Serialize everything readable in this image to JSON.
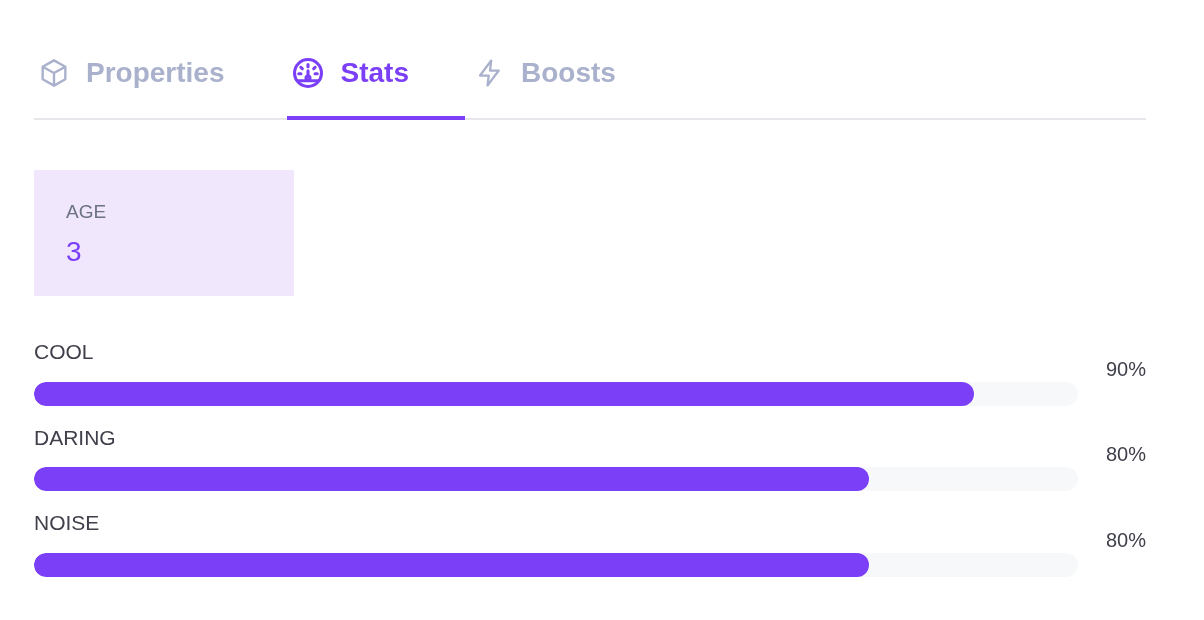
{
  "tabs": [
    {
      "label": "Properties",
      "selected": false
    },
    {
      "label": "Stats",
      "selected": true
    },
    {
      "label": "Boosts",
      "selected": false
    }
  ],
  "card": {
    "label": "AGE",
    "value": "3"
  },
  "stats": [
    {
      "name": "COOL",
      "level": 0.9,
      "reading": "90%"
    },
    {
      "name": "DARING",
      "level": 0.8,
      "reading": "80%"
    },
    {
      "name": "NOISE",
      "level": 0.8,
      "reading": "80%"
    }
  ]
}
